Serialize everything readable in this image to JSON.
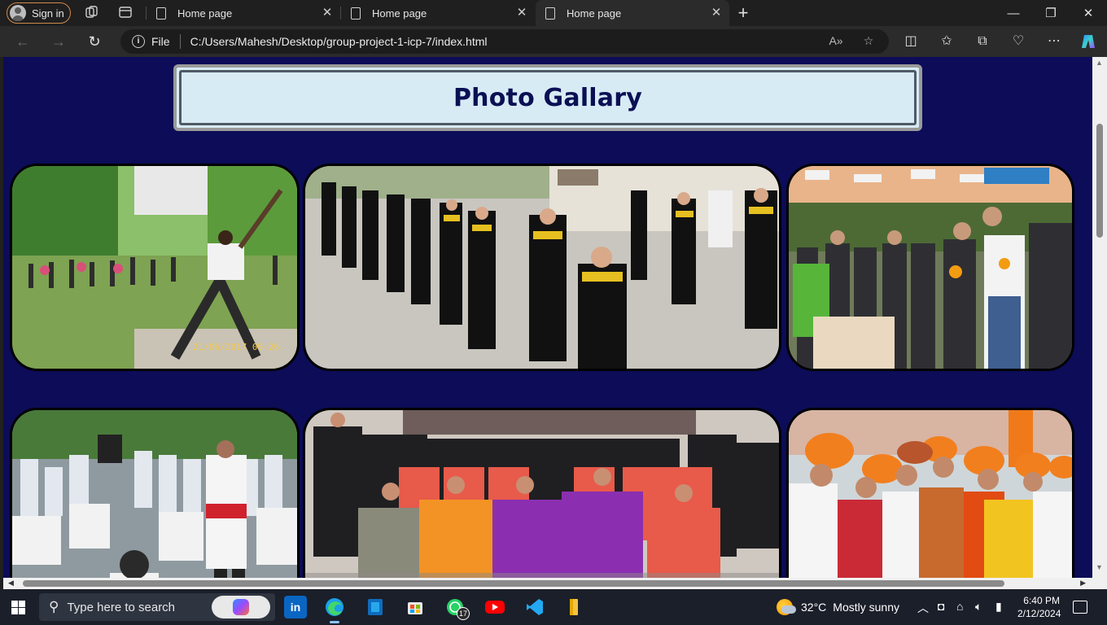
{
  "browser": {
    "profile_label": "Sign in",
    "tabs": [
      {
        "title": "Home page",
        "active": false
      },
      {
        "title": "Home page",
        "active": false
      },
      {
        "title": "Home page",
        "active": true
      }
    ],
    "address": {
      "scheme_label": "File",
      "url": "C:/Users/Mahesh/Desktop/group-project-1-icp-7/index.html"
    }
  },
  "page": {
    "heading": "Photo Gallary",
    "background_color": "#0c0c58",
    "heading_box_color": "#d7ebf5",
    "photos": [
      {
        "name": "yoga-session",
        "timestamp": "21/06/2017 09:26"
      },
      {
        "name": "graduation-procession"
      },
      {
        "name": "inauguration-ceremony"
      },
      {
        "name": "cultural-dance"
      },
      {
        "name": "convocation-group"
      },
      {
        "name": "traditional-attire-group"
      }
    ]
  },
  "taskbar": {
    "search_placeholder": "Type here to search",
    "apps": [
      {
        "icon": "linkedin-icon",
        "label": "in"
      },
      {
        "icon": "edge-icon",
        "active": true
      },
      {
        "icon": "outlook-icon"
      },
      {
        "icon": "microsoft-store-icon"
      },
      {
        "icon": "whatsapp-icon",
        "badge": "17"
      },
      {
        "icon": "youtube-icon"
      },
      {
        "icon": "vscode-icon"
      },
      {
        "icon": "file-explorer-icon"
      }
    ],
    "weather": {
      "temperature": "32°C",
      "condition": "Mostly sunny"
    },
    "time": "6:40 PM",
    "date": "2/12/2024"
  }
}
